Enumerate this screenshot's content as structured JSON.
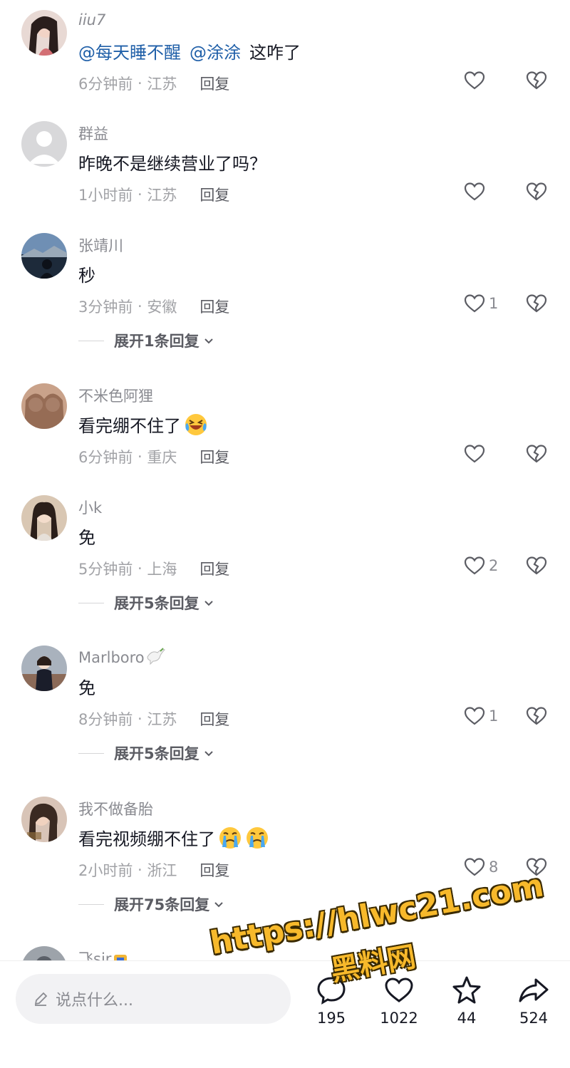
{
  "comments": [
    {
      "username": "iiu7",
      "mentions": [
        "@每天睡不醒",
        "@涂涂"
      ],
      "text": "这咋了",
      "time": "6分钟前",
      "location": "江苏",
      "reply_label": "回复",
      "likes": ""
    },
    {
      "username": "群益",
      "text": "昨晚不是继续营业了吗？",
      "time": "1小时前",
      "location": "江苏",
      "reply_label": "回复",
      "likes": ""
    },
    {
      "username": "张靖川",
      "text": "秒",
      "time": "3分钟前",
      "location": "安徽",
      "reply_label": "回复",
      "likes": "1",
      "expand": "展开1条回复"
    },
    {
      "username": "不米色阿狸",
      "text": "看完绷不住了",
      "emoji": "laughing-crying-emoji",
      "time": "6分钟前",
      "location": "重庆",
      "reply_label": "回复",
      "likes": ""
    },
    {
      "username": "小k",
      "text": "免",
      "time": "5分钟前",
      "location": "上海",
      "reply_label": "回复",
      "likes": "2",
      "expand": "展开5条回复"
    },
    {
      "username": "Marlboro",
      "username_icon": "dove-icon",
      "text": "免",
      "time": "8分钟前",
      "location": "江苏",
      "reply_label": "回复",
      "likes": "1",
      "expand": "展开5条回复"
    },
    {
      "username": "我不做备胎",
      "text": "看完视频绷不住了",
      "emoji": "crying-emoji",
      "time": "2小时前",
      "location": "浙江",
      "reply_label": "回复",
      "likes": "8",
      "expand": "展开75条回复"
    },
    {
      "username": "飞sir"
    }
  ],
  "bottom_bar": {
    "input_placeholder": "说点什么...",
    "comment_count": "195",
    "like_count": "1022",
    "favorite_count": "44",
    "share_count": "524"
  },
  "watermark": {
    "url": "https://hlwc21.com",
    "name": "黑料网"
  },
  "colors": {
    "mention": "#1f5fa8",
    "meta": "#a1a2a6",
    "watermark": "#f7b92b"
  }
}
